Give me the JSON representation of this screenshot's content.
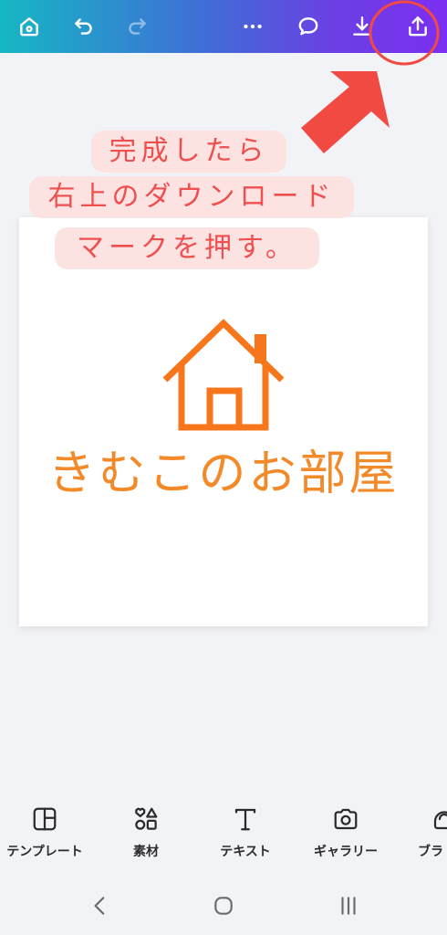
{
  "topbar": {
    "icons": [
      "home-icon",
      "undo-icon",
      "redo-icon",
      "more-icon",
      "comment-icon",
      "download-icon",
      "share-icon"
    ],
    "gradient": [
      "#16b7c4",
      "#7b2ff2"
    ]
  },
  "annotation": {
    "lines": [
      "完成したら",
      "右上のダウンロード",
      "マークを押す。"
    ],
    "text_color": "#ee4f4f",
    "bg_color": "#fde2e2",
    "arrow_color": "#f04a42"
  },
  "design": {
    "logo_text": "きむこのお部屋",
    "accent_color": "#f38a2a"
  },
  "bottom_toolbar": {
    "items": [
      {
        "label": "テンプレート",
        "icon": "template-icon"
      },
      {
        "label": "素材",
        "icon": "elements-icon"
      },
      {
        "label": "テキスト",
        "icon": "text-icon"
      },
      {
        "label": "ギャラリー",
        "icon": "camera-icon"
      },
      {
        "label": "ブラ",
        "icon": "brand-icon"
      }
    ]
  },
  "system_nav": {
    "icons": [
      "back-icon",
      "home-circle-icon",
      "recents-icon"
    ]
  }
}
